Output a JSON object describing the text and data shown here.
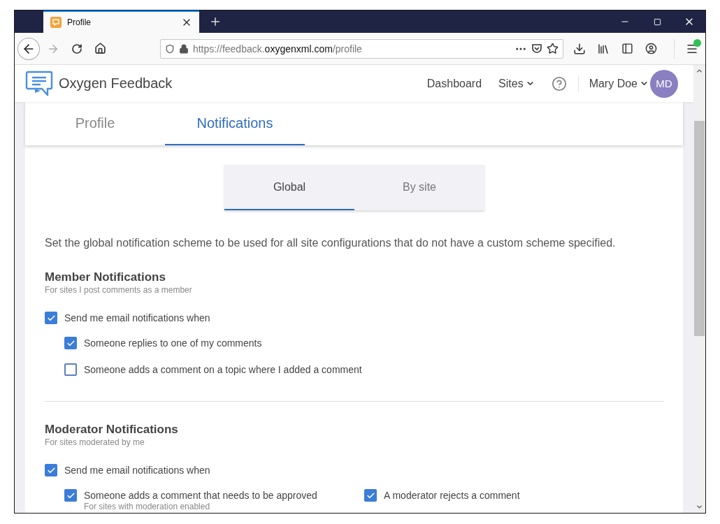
{
  "browser": {
    "tab_title": "Profile",
    "url": {
      "host_start": "https://feedback.",
      "domain": "oxygenxml.com",
      "path": "/profile"
    },
    "menu_update_badge": true
  },
  "header": {
    "brand": "Oxygen Feedback",
    "nav": [
      {
        "label": "Dashboard",
        "kind": "link"
      },
      {
        "label": "Sites",
        "kind": "dropdown"
      },
      {
        "kind": "help"
      }
    ],
    "user": {
      "name": "Mary Doe",
      "initials": "MD",
      "color": "#8a7fc0"
    }
  },
  "profile_tabs": [
    {
      "label": "Profile",
      "selected": false
    },
    {
      "label": "Notifications",
      "selected": true
    }
  ],
  "scope_tabs": [
    {
      "label": "Global",
      "selected": true
    },
    {
      "label": "By site",
      "selected": false
    }
  ],
  "description": "Set the global notification scheme to be used for all site configurations that do not have a custom scheme specified.",
  "sections": [
    {
      "title": "Member Notifications",
      "subtitle": "For sites I post comments as a member",
      "master": {
        "label": "Send me email notifications when",
        "checked": true
      },
      "option_columns": [
        [
          {
            "label": "Someone replies to one of my comments",
            "checked": true
          },
          {
            "label": "Someone adds a comment on a topic where I added a comment",
            "checked": false
          }
        ]
      ]
    },
    {
      "title": "Moderator Notifications",
      "subtitle": "For sites moderated by me",
      "master": {
        "label": "Send me email notifications when",
        "checked": true
      },
      "option_columns": [
        [
          {
            "label": "Someone adds a comment that needs to be approved",
            "note": "For sites with moderation enabled",
            "checked": true
          }
        ],
        [
          {
            "label": "A moderator rejects a comment",
            "checked": true
          }
        ]
      ]
    }
  ]
}
